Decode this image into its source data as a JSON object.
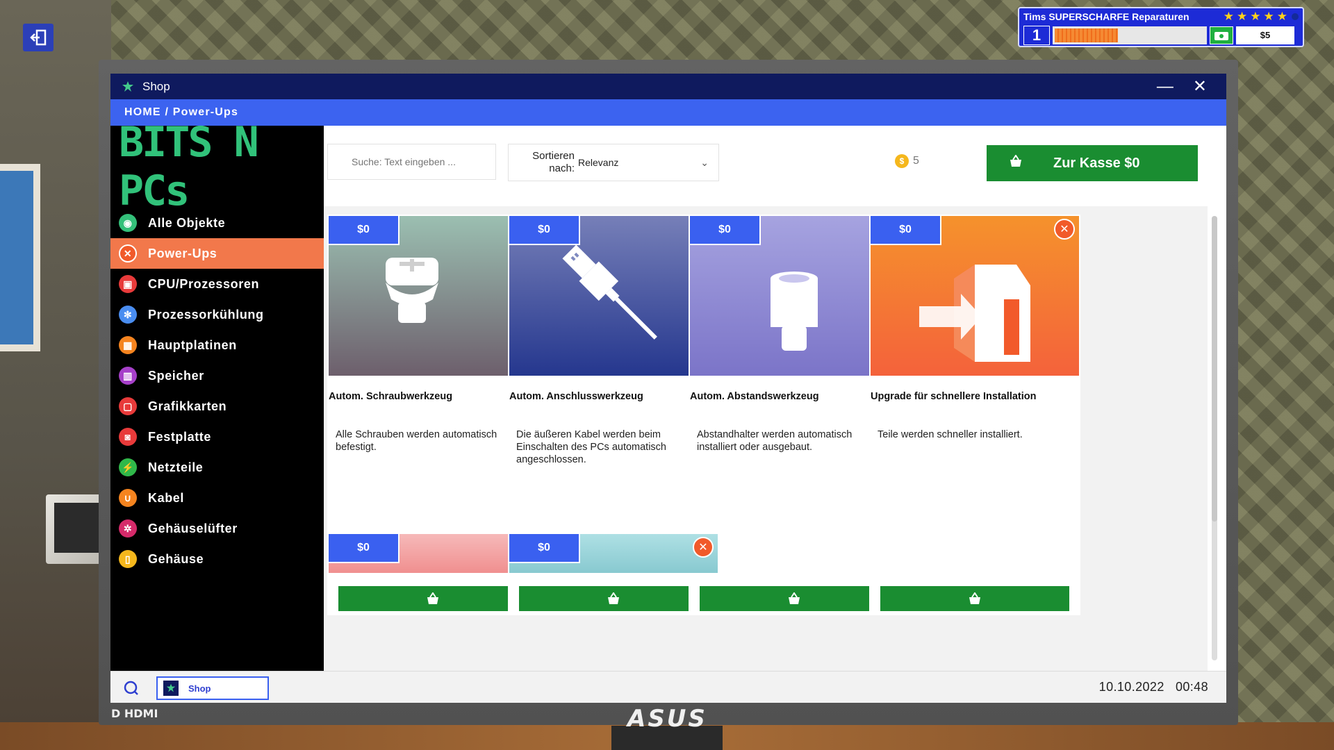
{
  "hud": {
    "title": "Tims SUPERSCHARFE Reparaturen",
    "stars": 5,
    "level": "1",
    "xp_fraction": 0.42,
    "money": "$5"
  },
  "window": {
    "title": "Shop",
    "minimize_label": "—",
    "close_label": "✕",
    "breadcrumb": "HOME / Power-Ups"
  },
  "brand": {
    "logo_text": "BITS N PCs"
  },
  "sidebar": {
    "items": [
      {
        "label": "Alle Objekte",
        "icon": "globe-icon",
        "color": "#34c07a",
        "glyph": "◉"
      },
      {
        "label": "Power-Ups",
        "icon": "tools-icon",
        "color": "#f15a2a",
        "glyph": "✕",
        "active": true
      },
      {
        "label": "CPU/Prozessoren",
        "icon": "cpu-icon",
        "color": "#e83a3a",
        "glyph": "▣"
      },
      {
        "label": "Prozessorkühlung",
        "icon": "cooling-fan-icon",
        "color": "#4a8df0",
        "glyph": "✻"
      },
      {
        "label": "Hauptplatinen",
        "icon": "motherboard-icon",
        "color": "#f5841f",
        "glyph": "▦"
      },
      {
        "label": "Speicher",
        "icon": "memory-icon",
        "color": "#a640c9",
        "glyph": "▥"
      },
      {
        "label": "Grafikkarten",
        "icon": "graphics-card-icon",
        "color": "#e83a3a",
        "glyph": "▢"
      },
      {
        "label": "Festplatte",
        "icon": "hard-drive-icon",
        "color": "#e83a3a",
        "glyph": "◙"
      },
      {
        "label": "Netzteile",
        "icon": "power-supply-icon",
        "color": "#30b84a",
        "glyph": "⚡"
      },
      {
        "label": "Kabel",
        "icon": "cable-icon",
        "color": "#f5841f",
        "glyph": "∪"
      },
      {
        "label": "Gehäuselüfter",
        "icon": "case-fan-icon",
        "color": "#d62a6a",
        "glyph": "✲"
      },
      {
        "label": "Gehäuse",
        "icon": "case-icon",
        "color": "#f5b71c",
        "glyph": "▯"
      }
    ]
  },
  "toolbar": {
    "search_placeholder": "Suche: Text eingeben ...",
    "sort_label": "Sortieren nach:",
    "sort_value": "Relevanz",
    "coins": "5",
    "checkout_label": "Zur Kasse $0"
  },
  "products": [
    {
      "price": "$0",
      "title": "Autom. Schraubwerkzeug",
      "description": "Alle Schrauben werden automatisch befestigt.",
      "image": "screw-icon",
      "colors": [
        "#9bbfb1",
        "#6d5f6c"
      ]
    },
    {
      "price": "$0",
      "title": "Autom. Anschlusswerkzeug",
      "description": "Die äußeren Kabel werden beim Einschalten des PCs automatisch angeschlossen.",
      "image": "usb-plug-icon",
      "colors": [
        "#767fb8",
        "#25378e"
      ]
    },
    {
      "price": "$0",
      "title": "Autom. Abstandswerkzeug",
      "description": "Abstandhalter werden automatisch installiert oder ausgebaut.",
      "image": "standoff-icon",
      "colors": [
        "#a6a3e0",
        "#7b74c8"
      ]
    },
    {
      "price": "$0",
      "title": "Upgrade für schnellere Installation",
      "description": "Teile werden schneller installiert.",
      "image": "fast-install-icon",
      "colors": [
        "#f5922c",
        "#f4623b"
      ]
    },
    {
      "price": "$0",
      "title": "",
      "description": "",
      "image": "",
      "colors": [
        "#f6b9b9",
        "#f08f8f"
      ]
    },
    {
      "price": "$0",
      "title": "",
      "description": "",
      "image": "",
      "colors": [
        "#aee0e4",
        "#88c9d0"
      ]
    }
  ],
  "taskbar": {
    "app_label": "Shop",
    "clock": "10.10.2022   00:48"
  },
  "bezel": {
    "hdmi": "D HDMI",
    "brand": "ASUS"
  }
}
